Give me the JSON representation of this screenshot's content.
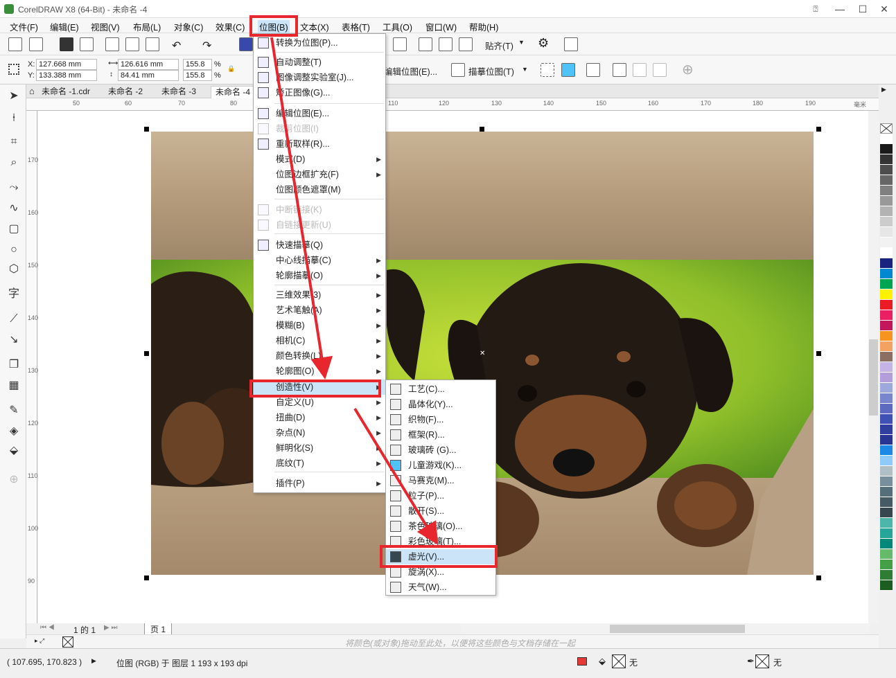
{
  "window": {
    "title": "CorelDRAW X8 (64-Bit) - 未命名 -4",
    "min": "—",
    "max": "☐",
    "close": "✕"
  },
  "menubar": [
    "文件(F)",
    "编辑(E)",
    "视图(V)",
    "布局(L)",
    "对象(C)",
    "效果(C)",
    "位图(B)",
    "文本(X)",
    "表格(T)",
    "工具(O)",
    "窗口(W)",
    "帮助(H)"
  ],
  "toolbar": {
    "snap_label": "贴齐(T)",
    "edit_bitmap": "编辑位图(E)...",
    "trace_bitmap": "描摹位图(T)"
  },
  "props": {
    "x_label": "X:",
    "x": "127.668 mm",
    "y_label": "Y:",
    "y": "133.388 mm",
    "w": "126.616 mm",
    "h": "84.41 mm",
    "sx": "155.8",
    "sy": "155.8",
    "pct": "%"
  },
  "tabs": [
    "未命名 -1.cdr",
    "未命名 -2",
    "未命名 -3",
    "未命名 -4"
  ],
  "ruler_h": [
    "50",
    "60",
    "70",
    "80",
    "110",
    "120",
    "130",
    "140",
    "150",
    "160",
    "170",
    "180",
    "190"
  ],
  "ruler_unit": "毫米",
  "ruler_v": [
    "170",
    "160",
    "150",
    "140",
    "130",
    "120",
    "110",
    "100",
    "90"
  ],
  "bitmap_menu": [
    {
      "label": "转换为位图(P)...",
      "arrow": false,
      "disabled": false
    },
    {
      "label": "自动调整(T)",
      "arrow": false,
      "disabled": false
    },
    {
      "label": "图像调整实验室(J)...",
      "arrow": false,
      "disabled": false
    },
    {
      "label": "矫正图像(G)...",
      "arrow": false,
      "disabled": false
    },
    {
      "label": "编辑位图(E)...",
      "arrow": false,
      "disabled": false
    },
    {
      "label": "裁剪位图(I)",
      "arrow": false,
      "disabled": true
    },
    {
      "label": "重新取样(R)...",
      "arrow": false,
      "disabled": false
    },
    {
      "label": "模式(D)",
      "arrow": true,
      "disabled": false
    },
    {
      "label": "位图边框扩充(F)",
      "arrow": true,
      "disabled": false
    },
    {
      "label": "位图颜色遮罩(M)",
      "arrow": false,
      "disabled": false
    },
    {
      "label": "中断链接(K)",
      "arrow": false,
      "disabled": true
    },
    {
      "label": "自链接更新(U)",
      "arrow": false,
      "disabled": true
    },
    {
      "label": "快速描摹(Q)",
      "arrow": false,
      "disabled": false
    },
    {
      "label": "中心线描摹(C)",
      "arrow": true,
      "disabled": false
    },
    {
      "label": "轮廓描摹(O)",
      "arrow": true,
      "disabled": false
    },
    {
      "label": "三维效果(3)",
      "arrow": true,
      "disabled": false
    },
    {
      "label": "艺术笔触(A)",
      "arrow": true,
      "disabled": false
    },
    {
      "label": "模糊(B)",
      "arrow": true,
      "disabled": false
    },
    {
      "label": "相机(C)",
      "arrow": true,
      "disabled": false
    },
    {
      "label": "颜色转换(L)",
      "arrow": true,
      "disabled": false
    },
    {
      "label": "轮廓图(O)",
      "arrow": true,
      "disabled": false
    },
    {
      "label": "创造性(V)",
      "arrow": true,
      "disabled": false
    },
    {
      "label": "自定义(U)",
      "arrow": true,
      "disabled": false
    },
    {
      "label": "扭曲(D)",
      "arrow": true,
      "disabled": false
    },
    {
      "label": "杂点(N)",
      "arrow": true,
      "disabled": false
    },
    {
      "label": "鲜明化(S)",
      "arrow": true,
      "disabled": false
    },
    {
      "label": "底纹(T)",
      "arrow": true,
      "disabled": false
    },
    {
      "label": "插件(P)",
      "arrow": true,
      "disabled": false
    }
  ],
  "creative_menu": [
    "工艺(C)...",
    "晶体化(Y)...",
    "织物(F)...",
    "框架(R)...",
    "玻璃砖 (G)...",
    "儿童游戏(K)...",
    "马赛克(M)...",
    "粒子(P)...",
    "散开(S)...",
    "茶色玻璃(O)...",
    "彩色玻璃(T)...",
    "虚光(V)...",
    "旋涡(X)...",
    "天气(W)..."
  ],
  "pagebar": {
    "page_pos": "1 的 1",
    "page_tab": "页 1"
  },
  "hint": "将颜色(或对象)拖动至此处，以便将这些颜色与文档存储在一起",
  "status": {
    "coords": "( 107.695, 170.823 )",
    "info": "位图 (RGB) 于 图层 1 193 x 193 dpi",
    "fill": "无",
    "outline": "无"
  },
  "palette_colors": [
    "#ffffff",
    "#1a1a1a",
    "#333333",
    "#4d4d4d",
    "#666666",
    "#808080",
    "#999999",
    "#b3b3b3",
    "#cccccc",
    "#e6e6e6",
    "#f2f2f2",
    "#ffffff",
    "#1a237e",
    "#0288d1",
    "#00a651",
    "#fff200",
    "#ed1c24",
    "#e91e63",
    "#c2185b",
    "#f7941d",
    "#f4a261",
    "#8d6e63",
    "#c5b3e6",
    "#b39ddb",
    "#9fa8da",
    "#7986cb",
    "#5c6bc0",
    "#3f51b5",
    "#303f9f",
    "#283593",
    "#1e88e5",
    "#90caf9",
    "#b0bec5",
    "#78909c",
    "#546e7a",
    "#455a64",
    "#37474f",
    "#4db6ac",
    "#26a69a",
    "#00897b",
    "#66bb6a",
    "#43a047",
    "#2e7d32",
    "#1b5e20"
  ]
}
